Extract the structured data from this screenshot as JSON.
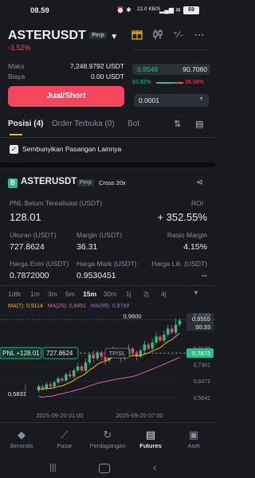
{
  "status": {
    "time": "08.59",
    "net": "22.0 KB/S",
    "batt": "69"
  },
  "header": {
    "symbol": "ASTERUSDT",
    "badge": "Perp",
    "change": "-3.52%"
  },
  "account": {
    "rows": [
      {
        "label": "Maks",
        "value": "7,248.9792 USDT"
      },
      {
        "label": "Biaya",
        "value": "0.00 USDT"
      }
    ],
    "action_label": "Jual/Short"
  },
  "orderbook": {
    "price1": "0.9548",
    "price2": "90.7060",
    "buy_pct": "63.92%",
    "sell_pct": "36.08%",
    "buy_ratio": 0.6392,
    "tick": "0.0001"
  },
  "tabs": [
    {
      "label": "Posisi (4)"
    },
    {
      "label": "Order Terbuka (0)"
    },
    {
      "label": "Bot"
    }
  ],
  "hide_pairs_label": "Sembunyikan Pasangan Lainnya",
  "position": {
    "icon_letter": "B",
    "symbol": "ASTERUSDT",
    "badge1": "Perp",
    "badge2": "Cross 20x",
    "pnl_label": "PNL Belum Terealisasi (USDT)",
    "pnl": "128.01",
    "roi_label": "ROI",
    "roi": "+ 352.55%",
    "size_label": "Ukuran (USDT)",
    "size": "727.8624",
    "margin_label": "Margin (USDT)",
    "margin": "36.31",
    "ratio_label": "Rasio Margin",
    "ratio": "4.15%",
    "entry_label": "Harga Entri (USDT)",
    "entry": "0.7872000",
    "mark_label": "Harga Mark (USDT)",
    "mark": "0.9530451",
    "liq_label": "Harga Lik. (USDT)",
    "liq": "--"
  },
  "timeframes": [
    "1dtk",
    "1m",
    "3m",
    "5m",
    "15m",
    "30m",
    "1j",
    "2j",
    "4j"
  ],
  "active_tf": "15m",
  "chart_data": {
    "type": "candlestick",
    "ma_labels": {
      "ma7": "MA(7): 0,9114",
      "ma25": "MA(25): 0,8491",
      "ma99": "MA(99): 0,9789"
    },
    "y_ticks": [
      "0,9789",
      "0,9555",
      "0,8130",
      "0,7301",
      "0,6472",
      "0,5642"
    ],
    "y_range": [
      0.52,
      1.0
    ],
    "countdown": "00:33",
    "current_price": "0,9555",
    "high_label": "0,9600",
    "low_label": "0,5831",
    "entry_line": "0,7872",
    "pnl_tag": "PNL +128.01",
    "size_tag": "727.8624",
    "tpsl_label": "TP/SL",
    "x_labels": [
      "2025-09-20 01:00",
      "2025-09-20 07:00"
    ],
    "candles": [
      [
        0.6,
        0.62,
        0.63,
        0.59
      ],
      [
        0.62,
        0.61,
        0.63,
        0.6
      ],
      [
        0.61,
        0.63,
        0.64,
        0.6
      ],
      [
        0.63,
        0.62,
        0.64,
        0.61
      ],
      [
        0.62,
        0.64,
        0.65,
        0.61
      ],
      [
        0.64,
        0.66,
        0.67,
        0.63
      ],
      [
        0.66,
        0.65,
        0.67,
        0.64
      ],
      [
        0.65,
        0.68,
        0.69,
        0.64
      ],
      [
        0.68,
        0.67,
        0.7,
        0.66
      ],
      [
        0.67,
        0.7,
        0.71,
        0.66
      ],
      [
        0.7,
        0.72,
        0.74,
        0.69
      ],
      [
        0.72,
        0.7,
        0.73,
        0.69
      ],
      [
        0.7,
        0.74,
        0.76,
        0.69
      ],
      [
        0.74,
        0.78,
        0.79,
        0.73
      ],
      [
        0.78,
        0.76,
        0.8,
        0.74
      ],
      [
        0.76,
        0.79,
        0.8,
        0.75
      ],
      [
        0.79,
        0.77,
        0.8,
        0.75
      ],
      [
        0.77,
        0.75,
        0.78,
        0.73
      ],
      [
        0.75,
        0.78,
        0.79,
        0.74
      ],
      [
        0.78,
        0.8,
        0.82,
        0.77
      ],
      [
        0.8,
        0.78,
        0.81,
        0.76
      ],
      [
        0.78,
        0.76,
        0.79,
        0.74
      ],
      [
        0.76,
        0.78,
        0.79,
        0.75
      ],
      [
        0.78,
        0.81,
        0.83,
        0.77
      ],
      [
        0.81,
        0.79,
        0.82,
        0.77
      ],
      [
        0.79,
        0.77,
        0.8,
        0.75
      ],
      [
        0.77,
        0.8,
        0.81,
        0.76
      ],
      [
        0.8,
        0.83,
        0.85,
        0.79
      ],
      [
        0.83,
        0.81,
        0.84,
        0.8
      ],
      [
        0.81,
        0.84,
        0.86,
        0.8
      ],
      [
        0.84,
        0.87,
        0.89,
        0.83
      ],
      [
        0.87,
        0.85,
        0.88,
        0.84
      ],
      [
        0.85,
        0.88,
        0.9,
        0.84
      ],
      [
        0.88,
        0.91,
        0.93,
        0.87
      ],
      [
        0.91,
        0.89,
        0.93,
        0.88
      ],
      [
        0.89,
        0.93,
        0.96,
        0.88
      ],
      [
        0.93,
        0.95,
        0.96,
        0.92
      ]
    ]
  },
  "nav": [
    {
      "label": "Beranda",
      "icon": "◆"
    },
    {
      "label": "Pasar",
      "icon": "⟋"
    },
    {
      "label": "Perdagangan",
      "icon": "↻"
    },
    {
      "label": "Futures",
      "icon": "▤"
    },
    {
      "label": "Aset",
      "icon": "▣"
    }
  ],
  "colors": {
    "up": "#2ebd85",
    "down": "#f6465d",
    "ma7": "#f0b90b",
    "ma25": "#e95aa8",
    "ma99": "#9b6bdf",
    "accent": "#f0b90b"
  }
}
